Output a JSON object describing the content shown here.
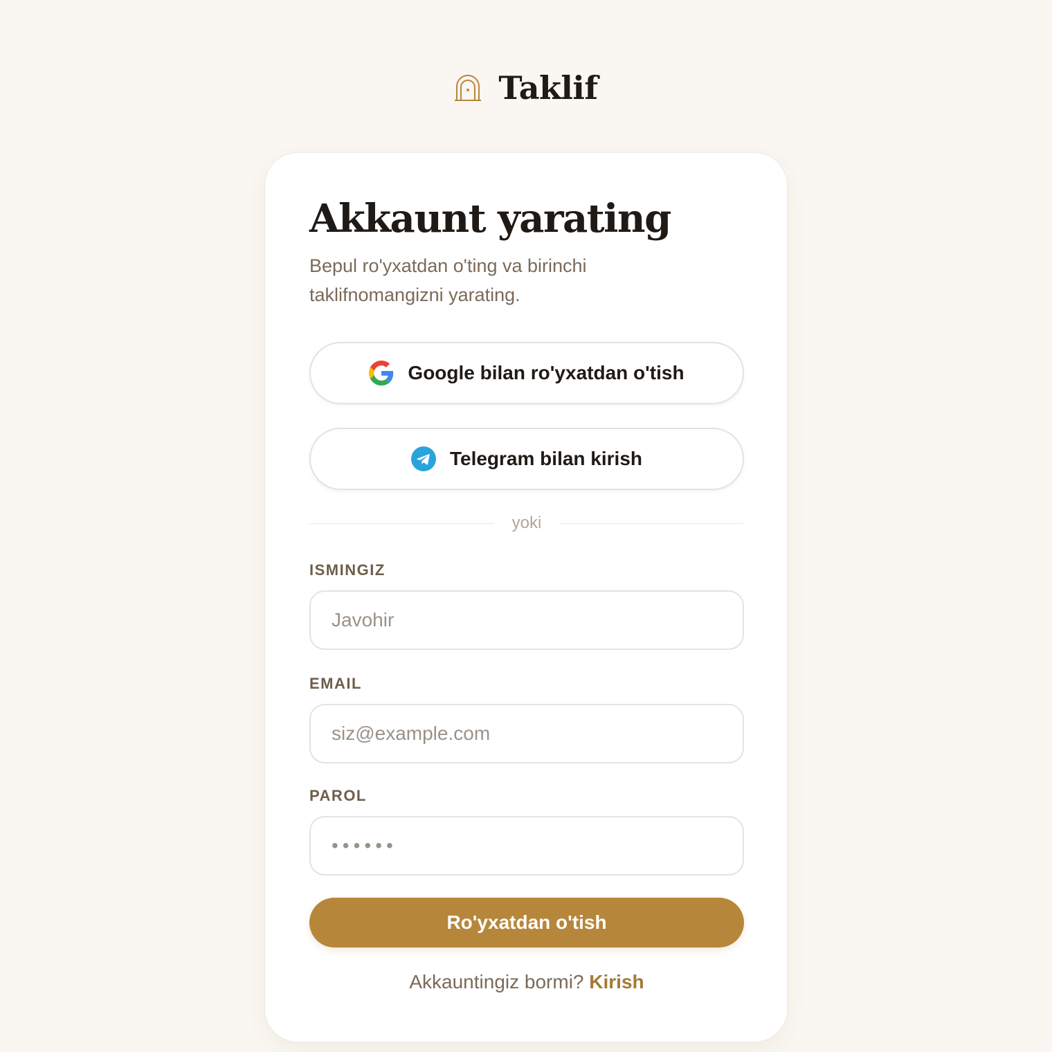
{
  "brand": {
    "name": "Taklif",
    "icon": "arch-door-icon",
    "icon_color": "#b6873b"
  },
  "signup": {
    "title": "Akkaunt yarating",
    "subtitle": "Bepul ro'yxatdan o'ting va birinchi taklifnomangizni yarating.",
    "google_button": {
      "label": "Google bilan ro'yxatdan o'tish",
      "icon": "google-icon"
    },
    "telegram_button": {
      "label": "Telegram bilan kirish",
      "icon": "telegram-icon",
      "icon_color": "#2aa3dd"
    },
    "divider_text": "yoki",
    "name_field": {
      "label": "ISMINGIZ",
      "placeholder": "Javohir",
      "value": ""
    },
    "email_field": {
      "label": "EMAIL",
      "placeholder": "siz@example.com",
      "value": ""
    },
    "password_field": {
      "label": "PAROL",
      "placeholder": "••••••",
      "value": ""
    },
    "submit_label": "Ro'yxatdan o'tish",
    "footer_text": "Akkauntingiz bormi?",
    "footer_link": "Kirish"
  },
  "colors": {
    "background": "#faf6f1",
    "accent": "#b6873b",
    "link": "#a37a35",
    "text_dark": "#1f1a15",
    "text_muted": "#7a6a58"
  }
}
